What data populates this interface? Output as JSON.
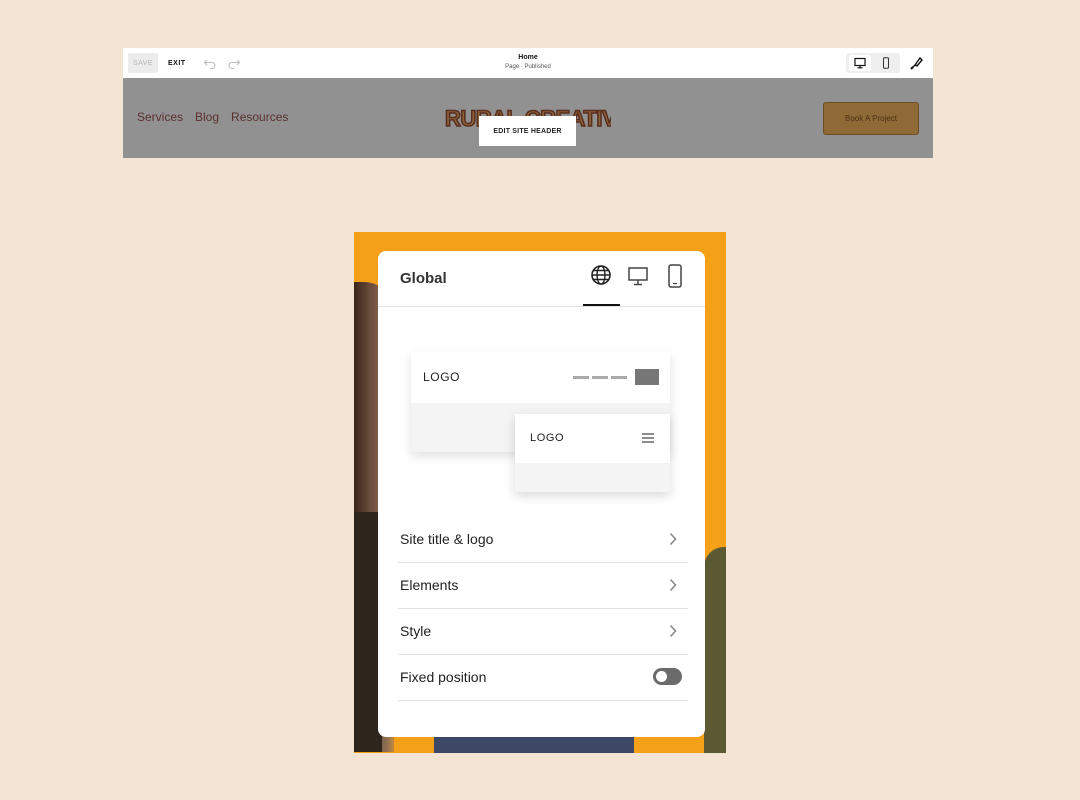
{
  "editor": {
    "save_label": "SAVE",
    "exit_label": "EXIT",
    "page_title": "Home",
    "page_status": "Page · Published"
  },
  "site_header": {
    "nav": [
      "Services",
      "Blog",
      "Resources"
    ],
    "logo_text": "RURAL CREATIVE CO",
    "edit_button": "EDIT SITE HEADER",
    "book_button": "Book A Project"
  },
  "panel": {
    "title": "Global",
    "preview_desktop_logo": "LOGO",
    "preview_mobile_logo": "LOGO",
    "rows": [
      {
        "label": "Site title & logo"
      },
      {
        "label": "Elements"
      },
      {
        "label": "Style"
      },
      {
        "label": "Fixed position"
      }
    ],
    "fixed_position_enabled": false
  },
  "colors": {
    "background": "#f3e4d4",
    "phone_bg": "#f4a018",
    "header_overlay": "#919191",
    "book_button": "#8d6a36"
  }
}
